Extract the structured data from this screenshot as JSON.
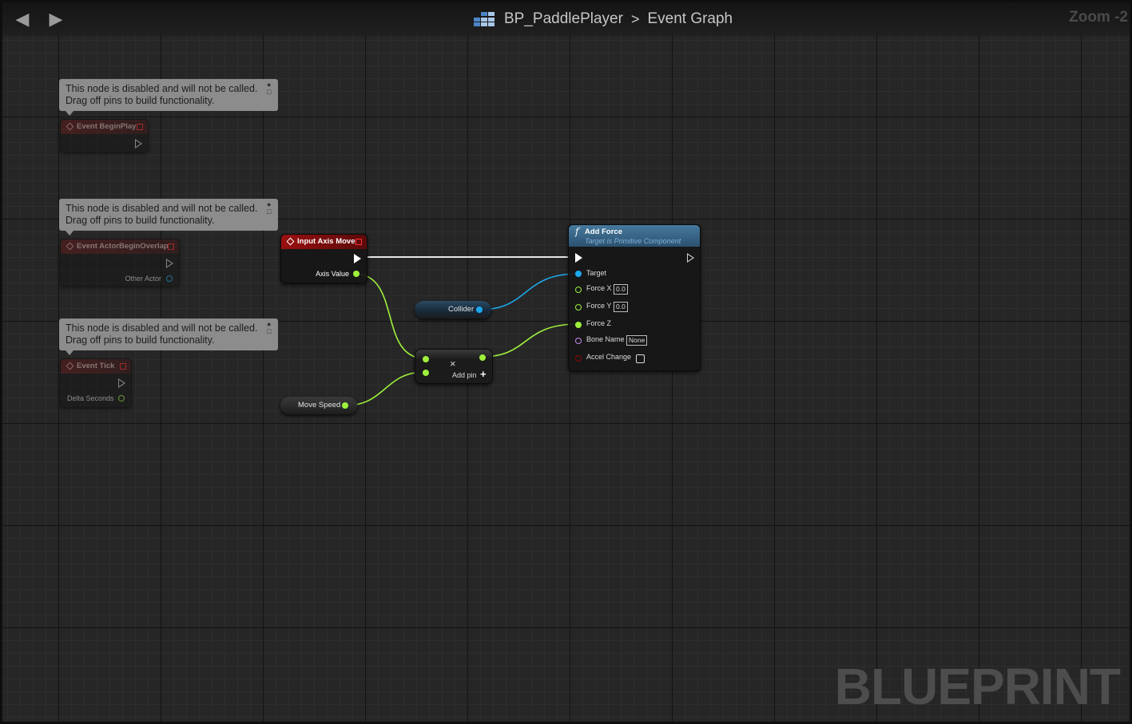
{
  "toolbar": {
    "back_icon": "arrow-left-icon",
    "forward_icon": "arrow-right-icon",
    "blueprint_icon": "blueprint-graph-icon",
    "blueprint_name": "BP_PaddlePlayer",
    "separator": ">",
    "graph_name": "Event Graph",
    "zoom": "Zoom -2"
  },
  "comments": [
    {
      "line1": "This node is disabled and will not be called.",
      "line2": "Drag off pins to build functionality."
    },
    {
      "line1": "This node is disabled and will not be called.",
      "line2": "Drag off pins to build functionality."
    },
    {
      "line1": "This node is disabled and will not be called.",
      "line2": "Drag off pins to build functionality."
    }
  ],
  "nodes": {
    "begin_play": {
      "title": "Event BeginPlay",
      "disabled": true
    },
    "begin_overlap": {
      "title": "Event ActorBeginOverlap",
      "disabled": true,
      "output": "Other Actor"
    },
    "tick": {
      "title": "Event Tick",
      "disabled": true,
      "output": "Delta Seconds"
    },
    "input_axis": {
      "title": "Input Axis Move",
      "output": "Axis Value"
    },
    "collider": {
      "label": "Collider"
    },
    "move_speed": {
      "label": "Move Speed"
    },
    "multiply": {
      "symbol": "×",
      "add_pin": "Add pin",
      "add_icon": "+"
    },
    "add_force": {
      "title": "Add Force",
      "subtitle": "Target is Primitive Component",
      "func_icon": "f",
      "inputs": {
        "target": "Target",
        "force_x": "Force X",
        "force_x_value": "0.0",
        "force_y": "Force Y",
        "force_y_value": "0.0",
        "force_z": "Force Z",
        "bone_name": "Bone Name",
        "bone_name_value": "None",
        "accel_change": "Accel Change"
      }
    }
  },
  "colors": {
    "exec": "#ffffff",
    "float": "#9ff03c",
    "object": "#1ea9ee",
    "name": "#c78cf0",
    "bool": "#8c0a0a",
    "event_header": "#8b1313",
    "function_header": "#3e6f93"
  },
  "watermark": "BLUEPRINT"
}
